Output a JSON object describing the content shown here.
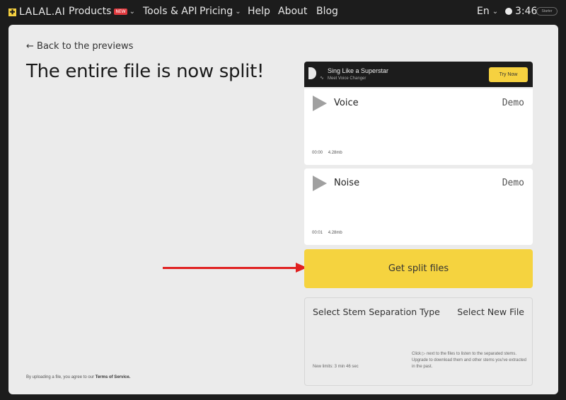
{
  "nav": {
    "logo_mark": "✚",
    "logo_text": "LALAL.AI",
    "products_label": "Products",
    "products_badge": "NEW",
    "tools_label": "Tools & API",
    "pricing_label": "Pricing",
    "help_label": "Help",
    "about_label": "About",
    "blog_label": "Blog",
    "language": "En",
    "time_left": "3:46",
    "plan_badge": "Starter"
  },
  "page": {
    "back_label": "← Back to the previews",
    "title": "The entire file is now split!",
    "terms_prefix": "By uploading a file, you agree to our",
    "terms_link": "Terms of Service."
  },
  "promo": {
    "title": "Sing Like a Superstar",
    "subtitle": "Meet Voice Changer",
    "cta": "Try Now"
  },
  "stems": [
    {
      "name": "Voice",
      "tag": "Demo",
      "time": "00:00",
      "size": "4.28mb"
    },
    {
      "name": "Noise",
      "tag": "Demo",
      "time": "00:01",
      "size": "4.28mb"
    }
  ],
  "actions": {
    "get_split_label": "Get split files"
  },
  "options": {
    "separation_type_label": "Select Stem Separation Type",
    "new_file_label": "Select New File",
    "limits_text": "New limits: 3 min 46 sec",
    "hint_text": "Click ▷ next to the files to listen to the separated stems. Upgrade to download them and other stems you've extracted in the past."
  },
  "colors": {
    "accent_yellow": "#f5d33f",
    "nav_bg": "#1c1c1c",
    "panel_bg": "#ebebeb",
    "arrow_red": "#e02020",
    "badge_red": "#e0393e"
  }
}
